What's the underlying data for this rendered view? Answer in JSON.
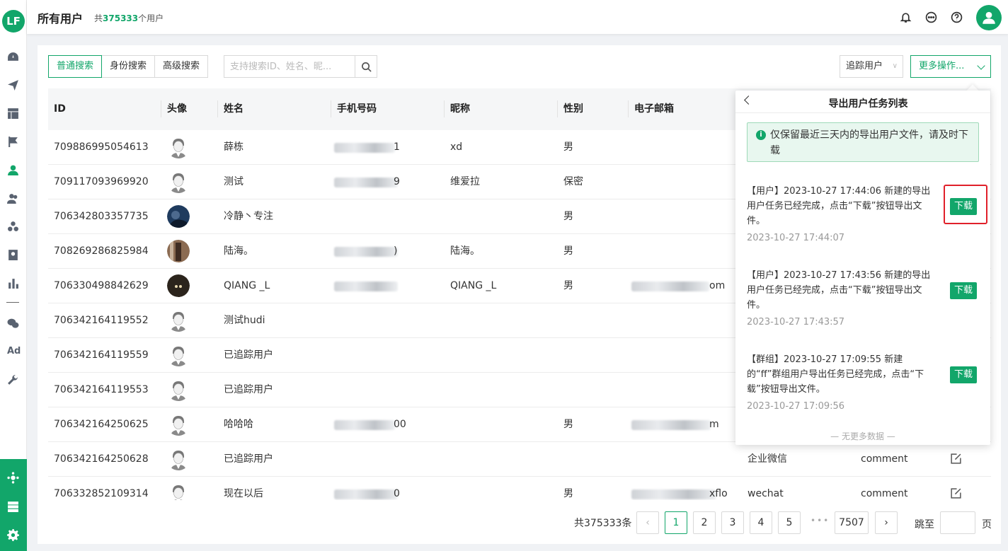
{
  "header": {
    "title": "所有用户",
    "total_prefix": "共",
    "total_count": "375333",
    "total_suffix": "个用户"
  },
  "sidebar": {
    "logo": "LF",
    "ad_label": "Ad"
  },
  "search": {
    "tabs": [
      "普通搜索",
      "身份搜索",
      "高级搜索"
    ],
    "placeholder": "支持搜索ID、姓名、昵..."
  },
  "toolbar": {
    "track_select": "追踪用户",
    "more_ops": "更多操作..."
  },
  "table": {
    "columns": [
      "ID",
      "头像",
      "姓名",
      "手机号码",
      "昵称",
      "性别",
      "电子邮箱"
    ],
    "rows": [
      {
        "id": "709886995054613",
        "name": "薛栋",
        "phone": "1",
        "nickname": "xd",
        "gender": "男",
        "email": "",
        "source": "",
        "comment": ""
      },
      {
        "id": "709117093969920",
        "name": "测试",
        "phone": "9",
        "nickname": "维爱拉",
        "gender": "保密",
        "email": "",
        "source": "",
        "comment": ""
      },
      {
        "id": "706342803357735",
        "name": "冷静丶专注",
        "phone": "",
        "nickname": "",
        "gender": "男",
        "email": "",
        "source": "",
        "comment": ""
      },
      {
        "id": "708269286825984",
        "name": "陆海。",
        "phone": ")",
        "nickname": "陆海。",
        "gender": "男",
        "email": "",
        "source": "",
        "comment": ""
      },
      {
        "id": "706330498842629",
        "name": "QIANG _L",
        "phone": "",
        "nickname": "QIANG _L",
        "gender": "男",
        "email": "om",
        "source": "",
        "comment": ""
      },
      {
        "id": "706342164119552",
        "name": "测试hudi",
        "phone": "",
        "nickname": "",
        "gender": "",
        "email": "",
        "source": "",
        "comment": ""
      },
      {
        "id": "706342164119559",
        "name": "已追踪用户",
        "phone": "",
        "nickname": "",
        "gender": "",
        "email": "",
        "source": "",
        "comment": ""
      },
      {
        "id": "706342164119553",
        "name": "已追踪用户",
        "phone": "",
        "nickname": "",
        "gender": "",
        "email": "",
        "source": "",
        "comment": ""
      },
      {
        "id": "706342164250625",
        "name": "哈哈哈",
        "phone": "00",
        "nickname": "",
        "gender": "男",
        "email": "m",
        "source": "",
        "comment": ""
      },
      {
        "id": "706342164250628",
        "name": "已追踪用户",
        "phone": "",
        "nickname": "",
        "gender": "",
        "email": "",
        "source": "企业微信",
        "comment": "comment"
      },
      {
        "id": "706332852109314",
        "name": "现在以后",
        "phone": "0",
        "nickname": "",
        "gender": "男",
        "email": "xflo",
        "source": "wechat",
        "comment": "comment"
      }
    ]
  },
  "pagination": {
    "total": "共375333条",
    "pages": [
      "1",
      "2",
      "3",
      "4",
      "5",
      "7507"
    ],
    "prev": "‹",
    "next": "›",
    "dots": "•••",
    "jump_label": "跳至",
    "page_label": "页"
  },
  "export_panel": {
    "title": "导出用户任务列表",
    "notice": "仅保留最近三天内的导出用户文件，请及时下载",
    "tasks": [
      {
        "text": "【用户】2023-10-27 17:44:06 新建的导出用户任务已经完成，点击“下载”按钮导出文件。",
        "time": "2023-10-27 17:44:07",
        "button": "下载"
      },
      {
        "text": "【用户】2023-10-27 17:43:56 新建的导出用户任务已经完成，点击“下载”按钮导出文件。",
        "time": "2023-10-27 17:43:57",
        "button": "下载"
      },
      {
        "text": "【群组】2023-10-27 17:09:55 新建的“ff”群组用户导出任务已经完成，点击“下载”按钮导出文件。",
        "time": "2023-10-27 17:09:56",
        "button": "下载"
      }
    ],
    "no_more": "— 无更多数据 —"
  },
  "colors": {
    "brand": "#12a66a",
    "highlight": "#e0202a"
  }
}
